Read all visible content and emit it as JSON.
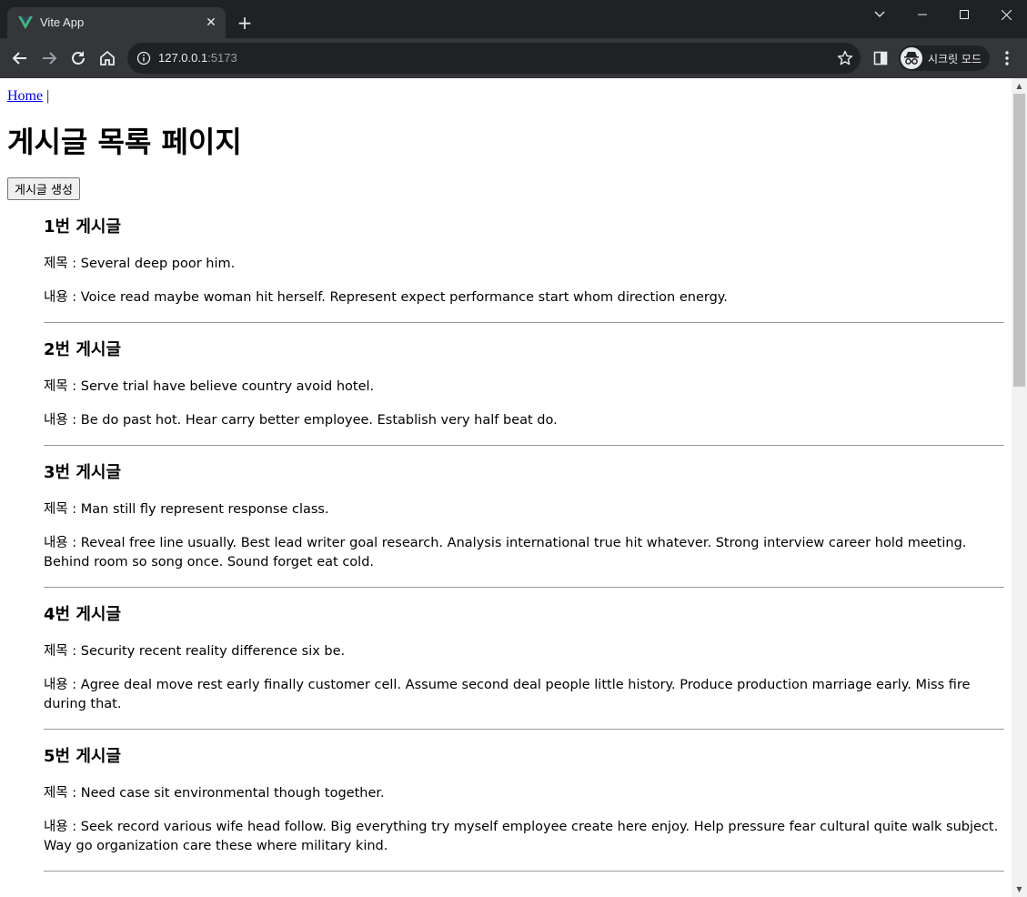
{
  "browser": {
    "tab_title": "Vite App",
    "tab_close": "✕",
    "new_tab": "+",
    "url_host": "127.0.0.1",
    "url_port": ":5173",
    "incognito_label": "시크릿 모드",
    "icons": [
      "vue-logo-icon",
      "close-icon",
      "plus-icon",
      "chevron-down-icon",
      "minimize-icon",
      "maximize-icon",
      "window-close-icon",
      "back-icon",
      "forward-icon",
      "reload-icon",
      "home-icon",
      "info-icon",
      "star-icon",
      "side-panel-icon",
      "incognito-icon",
      "more-vert-icon"
    ],
    "accent": "#41b883"
  },
  "nav": {
    "home_link": "Home",
    "separator": " |"
  },
  "page": {
    "title": "게시글 목록 페이지",
    "create_button": "게시글 생성"
  },
  "posts": [
    {
      "heading": "1번 게시글",
      "title": "제목 : Several deep poor him.",
      "content": "내용 : Voice read maybe woman hit herself. Represent expect performance start whom direction energy."
    },
    {
      "heading": "2번 게시글",
      "title": "제목 : Serve trial have believe country avoid hotel.",
      "content": "내용 : Be do past hot. Hear carry better employee. Establish very half beat do."
    },
    {
      "heading": "3번 게시글",
      "title": "제목 : Man still fly represent response class.",
      "content": "내용 : Reveal free line usually. Best lead writer goal research. Analysis international true hit whatever. Strong interview career hold meeting. Behind room so song once. Sound forget eat cold."
    },
    {
      "heading": "4번 게시글",
      "title": "제목 : Security recent reality difference six be.",
      "content": "내용 : Agree deal move rest early finally customer cell. Assume second deal people little history. Produce production marriage early. Miss fire during that."
    },
    {
      "heading": "5번 게시글",
      "title": "제목 : Need case sit environmental though together.",
      "content": "내용 : Seek record various wife head follow. Big everything try myself employee create here enjoy. Help pressure fear cultural quite walk subject. Way go organization care these where military kind."
    }
  ]
}
